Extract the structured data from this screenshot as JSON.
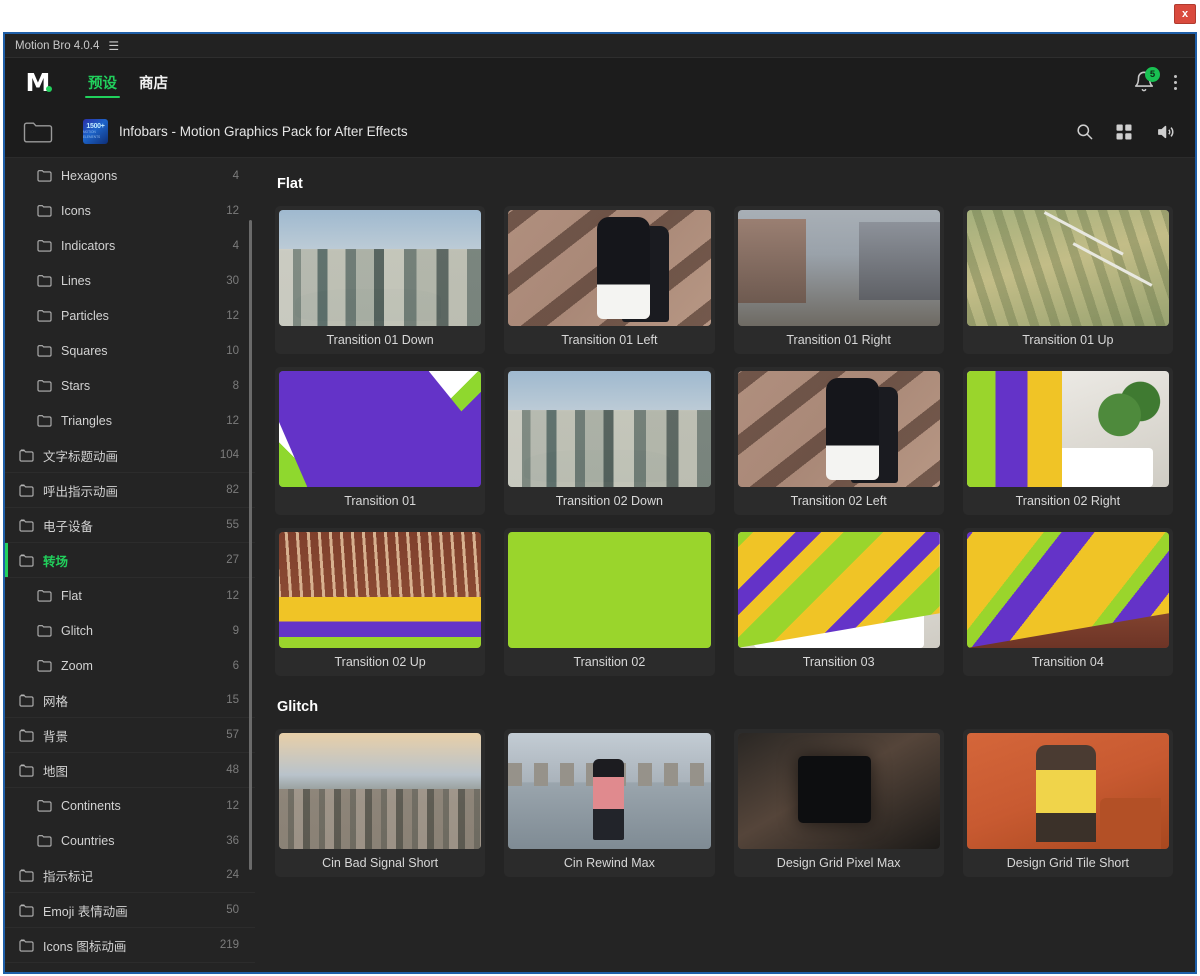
{
  "window": {
    "close_label": "x",
    "panel_title": "Motion Bro 4.0.4",
    "panel_menu_icon": "hamburger-icon"
  },
  "header": {
    "logo_text": "M",
    "tabs": [
      {
        "label": "预设",
        "active": true
      },
      {
        "label": "商店",
        "active": false
      }
    ],
    "notification_count": "5",
    "bell_icon": "bell-icon",
    "kebab_icon": "more-vertical-icon"
  },
  "breadcrumb": {
    "back_icon": "folder-icon",
    "badge_line1": "1500+",
    "badge_line2": "MOTION ELEMENTS",
    "title": "Infobars - Motion Graphics Pack for After Effects",
    "actions": [
      {
        "name": "search-icon"
      },
      {
        "name": "grid-view-icon"
      },
      {
        "name": "volume-icon"
      }
    ]
  },
  "sidebar": {
    "items": [
      {
        "label": "Hexagons",
        "count": "4",
        "level": 1,
        "active": false
      },
      {
        "label": "Icons",
        "count": "12",
        "level": 1,
        "active": false
      },
      {
        "label": "Indicators",
        "count": "4",
        "level": 1,
        "active": false
      },
      {
        "label": "Lines",
        "count": "30",
        "level": 1,
        "active": false
      },
      {
        "label": "Particles",
        "count": "12",
        "level": 1,
        "active": false
      },
      {
        "label": "Squares",
        "count": "10",
        "level": 1,
        "active": false
      },
      {
        "label": "Stars",
        "count": "8",
        "level": 1,
        "active": false
      },
      {
        "label": "Triangles",
        "count": "12",
        "level": 1,
        "active": false
      },
      {
        "label": "文字标题动画",
        "count": "104",
        "level": 0,
        "active": false
      },
      {
        "label": "呼出指示动画",
        "count": "82",
        "level": 0,
        "active": false
      },
      {
        "label": "电子设备",
        "count": "55",
        "level": 0,
        "active": false
      },
      {
        "label": "转场",
        "count": "27",
        "level": 0,
        "active": true
      },
      {
        "label": "Flat",
        "count": "12",
        "level": 1,
        "active": false
      },
      {
        "label": "Glitch",
        "count": "9",
        "level": 1,
        "active": false
      },
      {
        "label": "Zoom",
        "count": "6",
        "level": 1,
        "active": false
      },
      {
        "label": "网格",
        "count": "15",
        "level": 0,
        "active": false
      },
      {
        "label": "背景",
        "count": "57",
        "level": 0,
        "active": false
      },
      {
        "label": "地图",
        "count": "48",
        "level": 0,
        "active": false
      },
      {
        "label": "Continents",
        "count": "12",
        "level": 1,
        "active": false
      },
      {
        "label": "Countries",
        "count": "36",
        "level": 1,
        "active": false
      },
      {
        "label": "指示标记",
        "count": "24",
        "level": 0,
        "active": false
      },
      {
        "label": "Emoji 表情动画",
        "count": "50",
        "level": 0,
        "active": false
      },
      {
        "label": "Icons 图标动画",
        "count": "219",
        "level": 0,
        "active": false
      }
    ]
  },
  "content": {
    "sections": [
      {
        "title": "Flat",
        "cards": [
          {
            "label": "Transition 01 Down",
            "art": "sky-city"
          },
          {
            "label": "Transition 01 Left",
            "art": "shoes"
          },
          {
            "label": "Transition 01 Right",
            "art": "street"
          },
          {
            "label": "Transition 01 Up",
            "art": "field"
          },
          {
            "label": "Transition 01",
            "art": "flat-purple"
          },
          {
            "label": "Transition 02 Down",
            "art": "sky-city"
          },
          {
            "label": "Transition 02 Left",
            "art": "shoes"
          },
          {
            "label": "Transition 02 Right",
            "art": "bars-vert-room"
          },
          {
            "label": "Transition 02 Up",
            "art": "dirt-bars"
          },
          {
            "label": "Transition 02",
            "art": "flat-green"
          },
          {
            "label": "Transition 03",
            "art": "diag-3"
          },
          {
            "label": "Transition 04",
            "art": "diag-4"
          }
        ]
      },
      {
        "title": "Glitch",
        "cards": [
          {
            "label": "Cin Bad Signal Short",
            "art": "cityscape"
          },
          {
            "label": "Cin Rewind Max",
            "art": "bridge-river"
          },
          {
            "label": "Design Grid Pixel Max",
            "art": "phone-hands"
          },
          {
            "label": "Design Grid Tile Short",
            "art": "sofa-woman"
          }
        ]
      }
    ]
  },
  "colors": {
    "accent_green": "#21d05c",
    "flat_purple": "#6433c8",
    "flat_green": "#9ad52c",
    "flat_yellow": "#f0c426",
    "window_border": "#1f5fa8",
    "close_red": "#d94a3d"
  }
}
